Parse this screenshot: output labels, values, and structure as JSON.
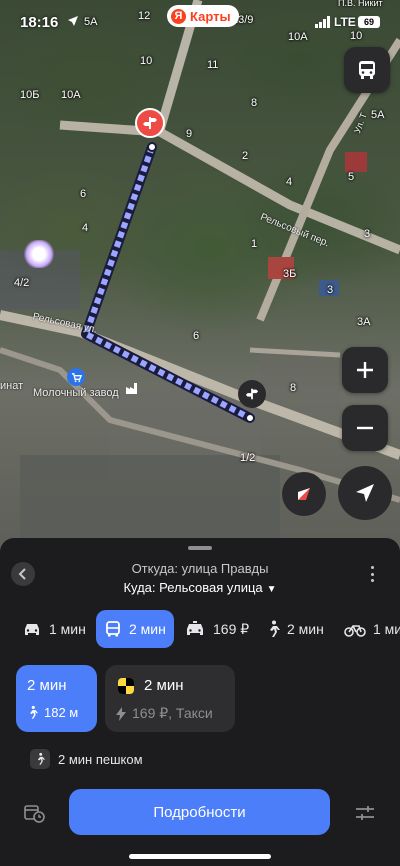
{
  "status": {
    "time": "18:16",
    "network": "LTE",
    "battery": "69"
  },
  "map": {
    "brand": "Карты",
    "brand_logo_letter": "Я",
    "labels": [
      "5А",
      "12",
      "13/9",
      "10А",
      "10",
      "П.В. Никит",
      "11",
      "10",
      "10Б",
      "10А",
      "8",
      "9",
      "5А",
      "2",
      "4",
      "5",
      "6",
      "4",
      "1",
      "3",
      "4/2",
      "3Б",
      "3",
      "3А",
      "6",
      "8",
      "1/2",
      "Ул. Т"
    ],
    "streets": {
      "relsovy_per": "Рельсовый пер.",
      "relsovaya_ul": "Рельсовая ул.",
      "poi_milk": "Молочный завод",
      "poi_kombinat": "инат"
    }
  },
  "panel": {
    "from": "Откуда: улица Правды",
    "to": "Куда: Рельсовая улица",
    "to_caret": "▼",
    "modes": [
      {
        "icon": "car-icon",
        "label": "1 мин",
        "active": false
      },
      {
        "icon": "bus-icon",
        "label": "2 мин",
        "active": true
      },
      {
        "icon": "taxi-icon",
        "label": "169 ₽",
        "active": false
      },
      {
        "icon": "walk-icon",
        "label": "2 мин",
        "active": false
      },
      {
        "icon": "bike-icon",
        "label": "1 ми",
        "active": false
      }
    ],
    "route_card": {
      "title": "2 мин",
      "walk_distance": "182 м"
    },
    "taxi_card": {
      "title": "2 мин",
      "subtitle": "169 ₽, Такси"
    },
    "walk_chip": "2 мин пешком",
    "details_button": "Подробности"
  },
  "colors": {
    "accent": "#4c7efa",
    "panel_bg": "#1c1c1e",
    "route_line": "#9aa6ff",
    "marker_red": "#ef4b46"
  }
}
